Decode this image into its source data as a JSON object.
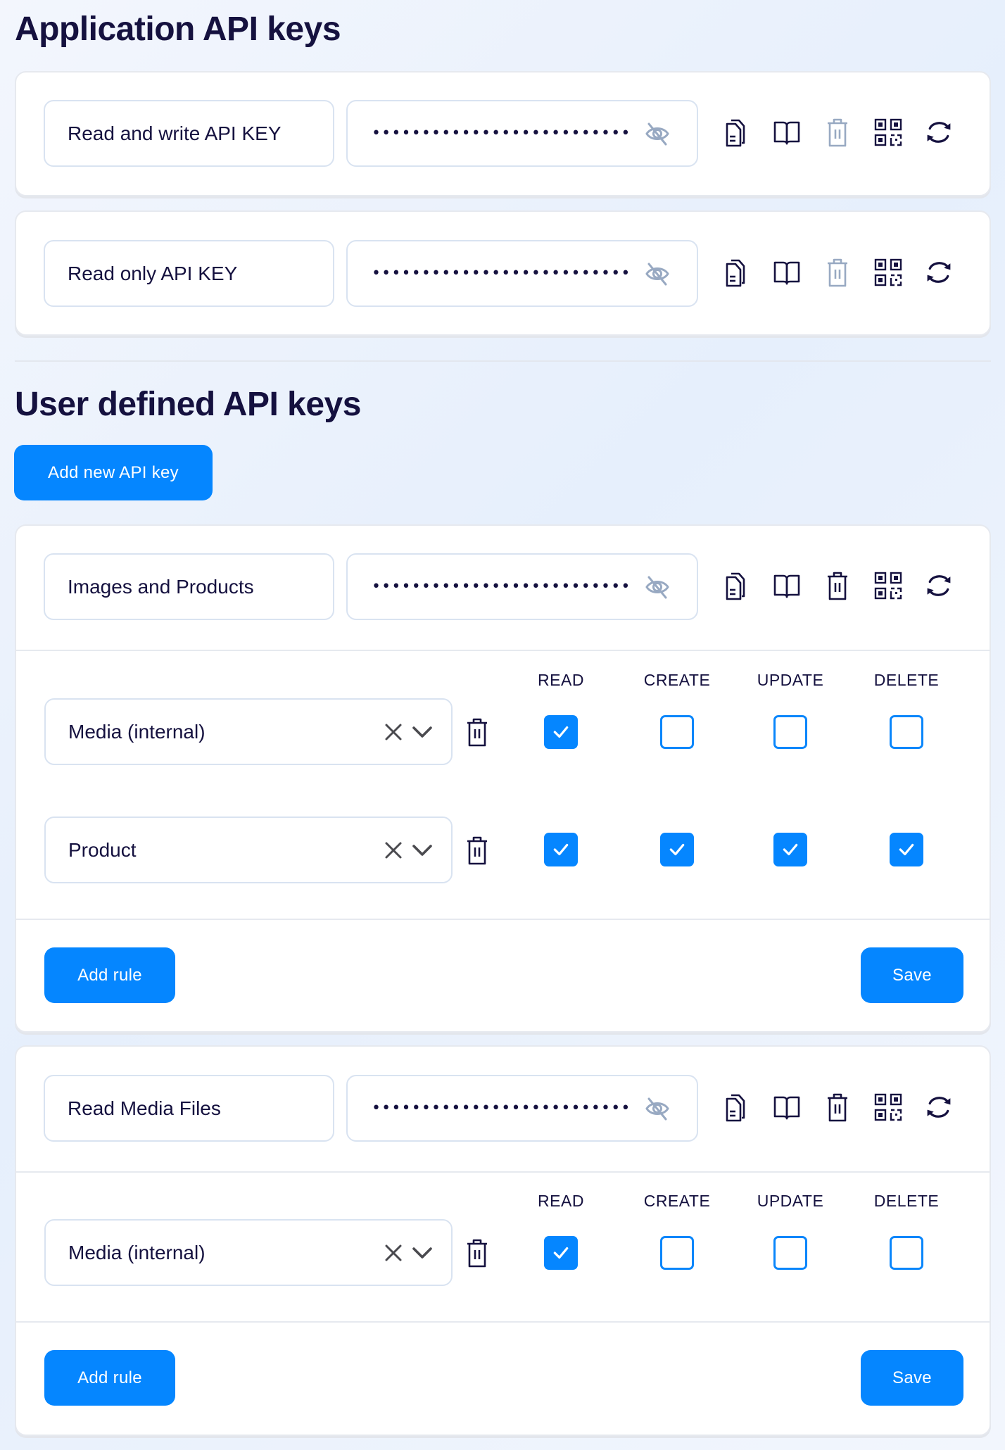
{
  "application_section": {
    "title": "Application API keys",
    "keys": [
      {
        "name": "Read and write API KEY",
        "masked_value": "••••••••••••••••••••••••••",
        "delete_enabled": false
      },
      {
        "name": "Read only API KEY",
        "masked_value": "••••••••••••••••••••••••••",
        "delete_enabled": false
      }
    ]
  },
  "user_section": {
    "title": "User defined API keys",
    "add_button_label": "Add new API key",
    "permission_headers": [
      "READ",
      "CREATE",
      "UPDATE",
      "DELETE"
    ],
    "keys": [
      {
        "name": "Images and Products",
        "masked_value": "••••••••••••••••••••••••••",
        "rules": [
          {
            "resource": "Media (internal)",
            "read": true,
            "create": false,
            "update": false,
            "delete": false
          },
          {
            "resource": "Product",
            "read": true,
            "create": true,
            "update": true,
            "delete": true
          }
        ],
        "add_rule_label": "Add rule",
        "save_label": "Save"
      },
      {
        "name": "Read Media Files",
        "masked_value": "••••••••••••••••••••••••••",
        "rules": [
          {
            "resource": "Media (internal)",
            "read": true,
            "create": false,
            "update": false,
            "delete": false
          }
        ],
        "add_rule_label": "Add rule",
        "save_label": "Save"
      }
    ]
  },
  "icons": {
    "visibility": "eye-off-icon",
    "copy": "copy-icon",
    "docs": "book-icon",
    "delete": "trash-icon",
    "qr": "qr-code-icon",
    "regenerate": "refresh-icon",
    "clear": "close-icon",
    "expand": "chevron-down-icon"
  },
  "colors": {
    "accent": "#0586ff",
    "text": "#15113f",
    "disabled_icon": "#98a9c2",
    "border": "#d9e3f1"
  }
}
